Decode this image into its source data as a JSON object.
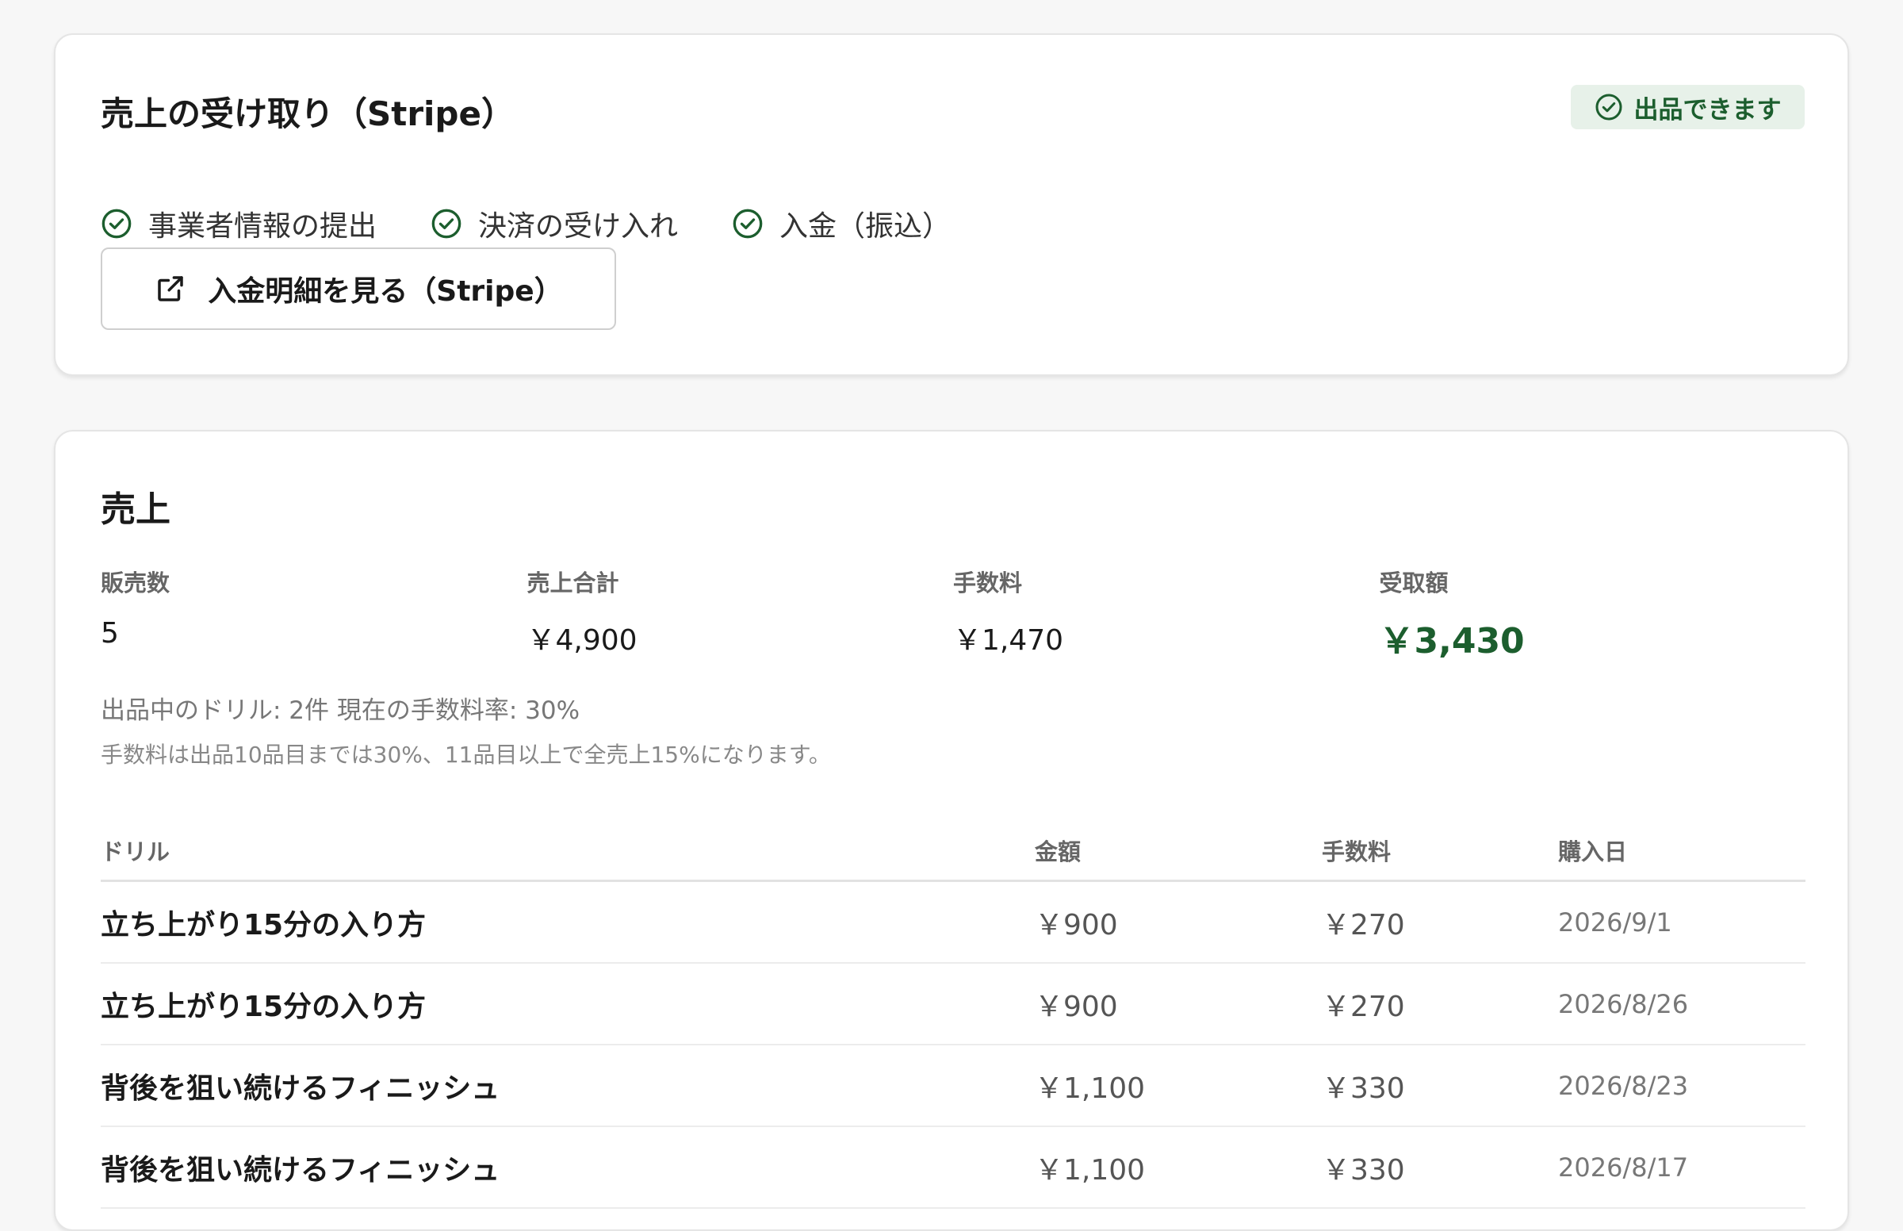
{
  "stripe_card": {
    "title": "売上の受け取り（Stripe）",
    "status_label": "出品できます",
    "requirements": [
      {
        "label": "事業者情報の提出"
      },
      {
        "label": "決済の受け入れ"
      },
      {
        "label": "入金（振込）"
      }
    ],
    "payout_button_label": "入金明細を見る（Stripe）"
  },
  "sales_card": {
    "title": "売上",
    "stats": [
      {
        "label": "販売数",
        "value": "5"
      },
      {
        "label": "売上合計",
        "value": "￥4,900"
      },
      {
        "label": "手数料",
        "value": "￥1,470"
      },
      {
        "label": "受取額",
        "value": "￥3,430"
      }
    ],
    "info_line_1": "出品中のドリル: 2件 現在の手数料率: 30%",
    "info_line_2": "手数料は出品10品目までは30%、11品目以上で全売上15%になります。",
    "table": {
      "columns": [
        "ドリル",
        "金額",
        "手数料",
        "購入日"
      ],
      "rows": [
        [
          "立ち上がり15分の入り方",
          "￥900",
          "￥270",
          "2026/9/1"
        ],
        [
          "立ち上がり15分の入り方",
          "￥900",
          "￥270",
          "2026/8/26"
        ],
        [
          "背後を狙い続けるフィニッシュ",
          "￥1,100",
          "￥330",
          "2026/8/23"
        ],
        [
          "背後を狙い続けるフィニッシュ",
          "￥1,100",
          "￥330",
          "2026/8/17"
        ]
      ]
    }
  },
  "colors": {
    "accent": "#1c5e2e",
    "badge_bg": "#e7f1e9",
    "page_bg": "#f7f7f7"
  },
  "icons": {
    "status": "check-circle-icon",
    "requirement": "check-circle-icon",
    "payout_button": "external-link-icon"
  }
}
